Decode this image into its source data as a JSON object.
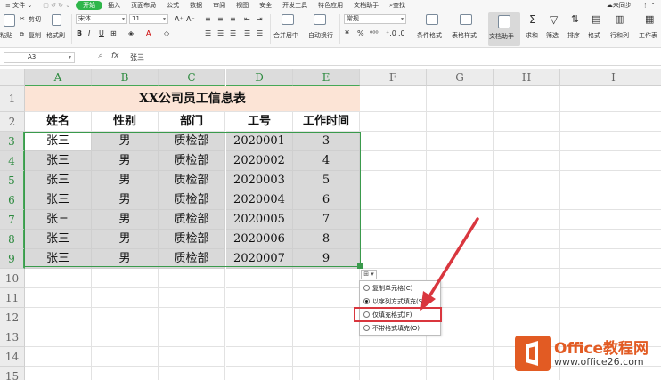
{
  "menubar": {
    "items": [
      {
        "label": "≡ 文件 ⌄",
        "active": false
      },
      {
        "label": "开始",
        "active": true
      },
      {
        "label": "插入",
        "active": false
      },
      {
        "label": "页面布局",
        "active": false
      },
      {
        "label": "公式",
        "active": false
      },
      {
        "label": "数据",
        "active": false
      },
      {
        "label": "审阅",
        "active": false
      },
      {
        "label": "视图",
        "active": false
      },
      {
        "label": "安全",
        "active": false
      },
      {
        "label": "开发工具",
        "active": false
      },
      {
        "label": "特色应用",
        "active": false
      },
      {
        "label": "文档助手",
        "active": false
      },
      {
        "label": "查找",
        "active": false
      }
    ],
    "sync_status": "未同步"
  },
  "ribbon": {
    "paste_label": "粘贴",
    "cut_label": "剪切",
    "copy_label": "复制",
    "format_painter_label": "格式刷",
    "font_name": "宋体",
    "font_size": "11",
    "number_format": "常规",
    "merge_center_label": "合并居中",
    "wrap_text_label": "自动换行",
    "conditional_format_label": "条件格式",
    "table_style_label": "表格样式",
    "doc_helper_label": "文档助手",
    "sum_label": "求和",
    "filter_label": "筛选",
    "sort_label": "排序",
    "format_label": "格式",
    "row_col_label": "行和列",
    "worksheet_label": "工作表"
  },
  "formula_bar": {
    "cell_ref": "A3",
    "fx": "fx",
    "value": "张三"
  },
  "sheet": {
    "columns": [
      "A",
      "B",
      "C",
      "D",
      "E",
      "F",
      "G",
      "H",
      "I"
    ],
    "rows": [
      "1",
      "2",
      "3",
      "4",
      "5",
      "6",
      "7",
      "8",
      "9",
      "10",
      "11",
      "12",
      "13",
      "14",
      "15"
    ],
    "title": "XX公司员工信息表",
    "headers": [
      "姓名",
      "性别",
      "部门",
      "工号",
      "工作时间"
    ],
    "data": [
      [
        "张三",
        "男",
        "质检部",
        "2020001",
        "3"
      ],
      [
        "张三",
        "男",
        "质检部",
        "2020002",
        "4"
      ],
      [
        "张三",
        "男",
        "质检部",
        "2020003",
        "5"
      ],
      [
        "张三",
        "男",
        "质检部",
        "2020004",
        "6"
      ],
      [
        "张三",
        "男",
        "质检部",
        "2020005",
        "7"
      ],
      [
        "张三",
        "男",
        "质检部",
        "2020006",
        "8"
      ],
      [
        "张三",
        "男",
        "质检部",
        "2020007",
        "9"
      ]
    ]
  },
  "autofill": {
    "button_label": "⊞ ▾",
    "options": [
      {
        "label": "复制单元格(C)",
        "checked": false
      },
      {
        "label": "以序列方式填充(S)",
        "checked": true
      },
      {
        "label": "仅填充格式(F)",
        "checked": false
      },
      {
        "label": "不带格式填充(O)",
        "checked": false
      }
    ]
  },
  "watermark": {
    "title": "Office教程网",
    "url": "www.office26.com"
  },
  "colors": {
    "accent_green": "#2fb64a",
    "selection_green": "#3a9a4c",
    "title_fill": "#fce4d6",
    "data_fill": "#d9d9d9",
    "annotation_red": "#d9363e",
    "watermark_orange": "#e25b23"
  }
}
